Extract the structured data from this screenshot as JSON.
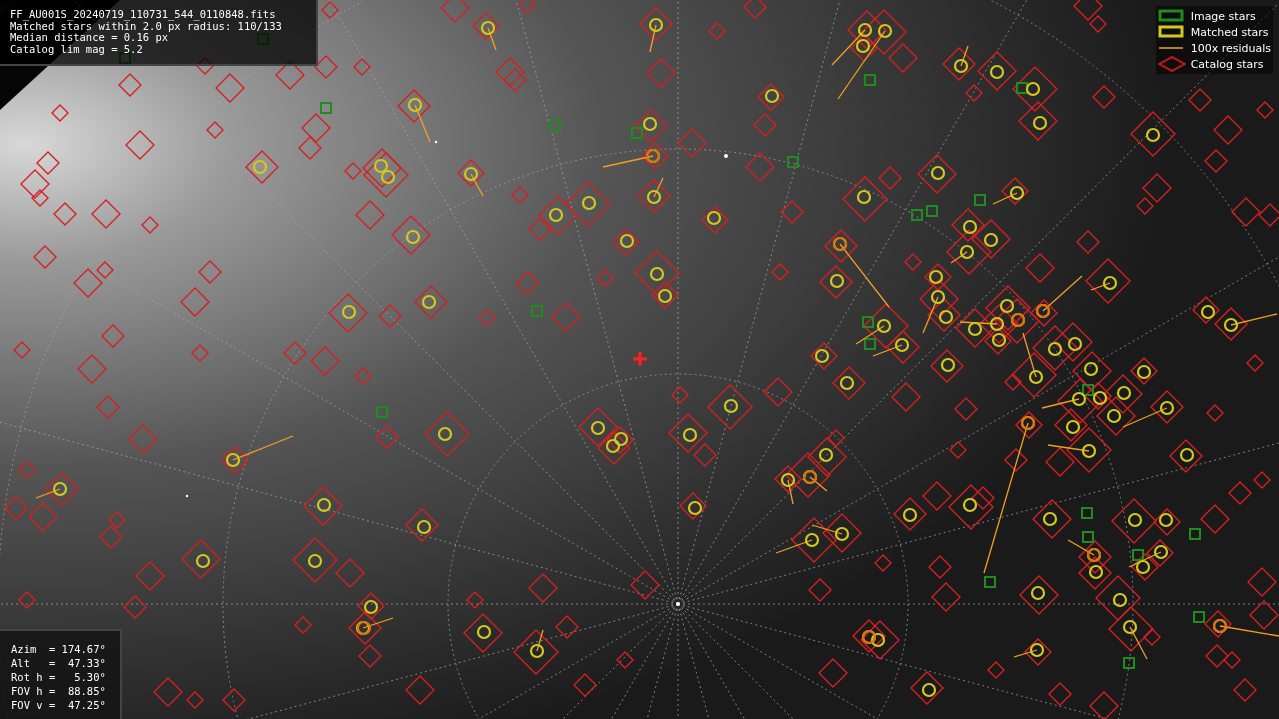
{
  "info_panel": {
    "lines": [
      "FF_AU001S_20240719_110731_544_0110848.fits",
      "Matched stars within 2.0 px radius: 110/133",
      "Median distance = 0.16 px",
      "Catalog lim mag = 5.2"
    ]
  },
  "legend": [
    {
      "kind": "image",
      "label": "Image stars"
    },
    {
      "kind": "matched",
      "label": "Matched stars"
    },
    {
      "kind": "residual",
      "label": "100x residuals"
    },
    {
      "kind": "catalog",
      "label": "Catalog stars"
    }
  ],
  "pointing_panel": {
    "lines": [
      "Azim  = 174.67°",
      "Alt   =  47.33°",
      "Rot h =   5.30°",
      "FOV h =  88.85°",
      "FOV v =  47.25°"
    ]
  }
}
